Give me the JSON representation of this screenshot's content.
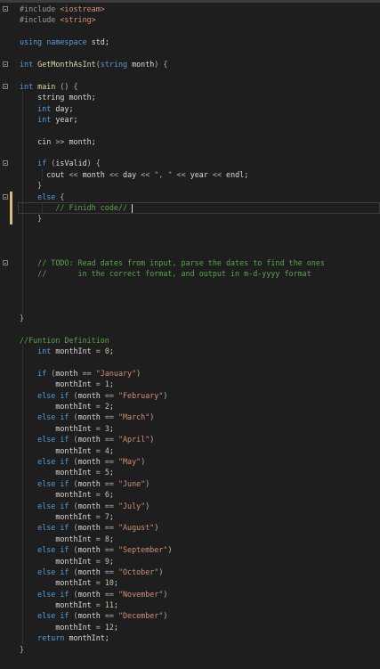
{
  "editor": {
    "lines": [
      {
        "fold": true,
        "indent": "",
        "tokens": [
          [
            "pp",
            "#include "
          ],
          [
            "str",
            "<iostream>"
          ]
        ]
      },
      {
        "fold": false,
        "indent": "",
        "tokens": [
          [
            "pp",
            "#include "
          ],
          [
            "str",
            "<string>"
          ]
        ]
      },
      {
        "fold": false,
        "indent": "",
        "tokens": []
      },
      {
        "fold": false,
        "indent": "",
        "tokens": [
          [
            "kw",
            "using "
          ],
          [
            "kw",
            "namespace "
          ],
          [
            "id",
            "std;"
          ]
        ]
      },
      {
        "fold": false,
        "indent": "",
        "tokens": []
      },
      {
        "fold": true,
        "indent": "",
        "tokens": [
          [
            "kw",
            "int "
          ],
          [
            "fn",
            "GetMonthAsInt"
          ],
          [
            "op",
            "("
          ],
          [
            "kw",
            "string "
          ],
          [
            "id",
            "month"
          ],
          [
            "op",
            ") {"
          ]
        ]
      },
      {
        "fold": false,
        "indent": "",
        "tokens": []
      },
      {
        "fold": true,
        "indent": "",
        "tokens": [
          [
            "kw",
            "int "
          ],
          [
            "fn",
            "main"
          ],
          [
            "op",
            " () {"
          ]
        ]
      },
      {
        "fold": false,
        "indent": "    ",
        "tokens": [
          [
            "id",
            "string month;"
          ]
        ]
      },
      {
        "fold": false,
        "indent": "    ",
        "tokens": [
          [
            "kw",
            "int "
          ],
          [
            "id",
            "day;"
          ]
        ]
      },
      {
        "fold": false,
        "indent": "    ",
        "tokens": [
          [
            "kw",
            "int "
          ],
          [
            "id",
            "year;"
          ]
        ]
      },
      {
        "fold": false,
        "indent": "",
        "tokens": []
      },
      {
        "fold": false,
        "indent": "    ",
        "tokens": [
          [
            "id",
            "cin "
          ],
          [
            "op",
            ">> "
          ],
          [
            "id",
            "month;"
          ]
        ]
      },
      {
        "fold": false,
        "indent": "",
        "tokens": []
      },
      {
        "fold": true,
        "indent": "    ",
        "tokens": [
          [
            "kw",
            "if "
          ],
          [
            "op",
            "("
          ],
          [
            "id",
            "isValid"
          ],
          [
            "op",
            ") {"
          ]
        ]
      },
      {
        "fold": false,
        "indent": "      ",
        "tokens": [
          [
            "id",
            "cout "
          ],
          [
            "op",
            "<< "
          ],
          [
            "id",
            "month "
          ],
          [
            "op",
            "<< "
          ],
          [
            "id",
            "day "
          ],
          [
            "op",
            "<< "
          ],
          [
            "str",
            "\", \""
          ],
          [
            "op",
            " << "
          ],
          [
            "id",
            "year "
          ],
          [
            "op",
            "<< "
          ],
          [
            "id",
            "endl;"
          ]
        ]
      },
      {
        "fold": false,
        "indent": "    ",
        "tokens": [
          [
            "op",
            "}"
          ]
        ]
      },
      {
        "fold": true,
        "indent": "    ",
        "tokens": [
          [
            "kw",
            "else "
          ],
          [
            "op",
            "{"
          ]
        ]
      },
      {
        "fold": false,
        "indent": "        ",
        "tokens": [
          [
            "cm",
            "// Finidh code// "
          ]
        ]
      },
      {
        "fold": false,
        "indent": "    ",
        "tokens": [
          [
            "op",
            "}"
          ]
        ]
      },
      {
        "fold": false,
        "indent": "",
        "tokens": []
      },
      {
        "fold": false,
        "indent": "",
        "tokens": []
      },
      {
        "fold": false,
        "indent": "",
        "tokens": []
      },
      {
        "fold": true,
        "indent": "    ",
        "tokens": [
          [
            "cm",
            "// TODO: Read dates from input, parse the dates to find the ones"
          ]
        ]
      },
      {
        "fold": false,
        "indent": "    ",
        "tokens": [
          [
            "cm",
            "//       in the correct format, and output in m-d-yyyy format"
          ]
        ]
      },
      {
        "fold": false,
        "indent": "",
        "tokens": []
      },
      {
        "fold": false,
        "indent": "",
        "tokens": []
      },
      {
        "fold": false,
        "indent": "",
        "tokens": []
      },
      {
        "fold": false,
        "indent": "",
        "tokens": [
          [
            "op",
            "}"
          ]
        ]
      },
      {
        "fold": false,
        "indent": "",
        "tokens": []
      },
      {
        "fold": false,
        "indent": "",
        "tokens": [
          [
            "cm",
            "//Funtion Definition"
          ]
        ]
      },
      {
        "fold": false,
        "indent": "    ",
        "tokens": [
          [
            "kw",
            "int "
          ],
          [
            "id",
            "monthInt "
          ],
          [
            "op",
            "= "
          ],
          [
            "num",
            "0"
          ],
          [
            "id",
            ";"
          ]
        ]
      },
      {
        "fold": false,
        "indent": "",
        "tokens": []
      },
      {
        "fold": false,
        "indent": "    ",
        "tokens": [
          [
            "kw",
            "if "
          ],
          [
            "op",
            "("
          ],
          [
            "id",
            "month "
          ],
          [
            "op",
            "== "
          ],
          [
            "str",
            "\"January\""
          ],
          [
            "op",
            ")"
          ]
        ]
      },
      {
        "fold": false,
        "indent": "        ",
        "tokens": [
          [
            "id",
            "monthInt "
          ],
          [
            "op",
            "= "
          ],
          [
            "num",
            "1"
          ],
          [
            "id",
            ";"
          ]
        ]
      },
      {
        "fold": false,
        "indent": "    ",
        "tokens": [
          [
            "kw",
            "else if "
          ],
          [
            "op",
            "("
          ],
          [
            "id",
            "month "
          ],
          [
            "op",
            "== "
          ],
          [
            "str",
            "\"February\""
          ],
          [
            "op",
            ")"
          ]
        ]
      },
      {
        "fold": false,
        "indent": "        ",
        "tokens": [
          [
            "id",
            "monthInt "
          ],
          [
            "op",
            "= "
          ],
          [
            "num",
            "2"
          ],
          [
            "id",
            ";"
          ]
        ]
      },
      {
        "fold": false,
        "indent": "    ",
        "tokens": [
          [
            "kw",
            "else if "
          ],
          [
            "op",
            "("
          ],
          [
            "id",
            "month "
          ],
          [
            "op",
            "== "
          ],
          [
            "str",
            "\"March\""
          ],
          [
            "op",
            ")"
          ]
        ]
      },
      {
        "fold": false,
        "indent": "        ",
        "tokens": [
          [
            "id",
            "monthInt "
          ],
          [
            "op",
            "= "
          ],
          [
            "num",
            "3"
          ],
          [
            "id",
            ";"
          ]
        ]
      },
      {
        "fold": false,
        "indent": "    ",
        "tokens": [
          [
            "kw",
            "else if "
          ],
          [
            "op",
            "("
          ],
          [
            "id",
            "month "
          ],
          [
            "op",
            "== "
          ],
          [
            "str",
            "\"April\""
          ],
          [
            "op",
            ")"
          ]
        ]
      },
      {
        "fold": false,
        "indent": "        ",
        "tokens": [
          [
            "id",
            "monthInt "
          ],
          [
            "op",
            "= "
          ],
          [
            "num",
            "4"
          ],
          [
            "id",
            ";"
          ]
        ]
      },
      {
        "fold": false,
        "indent": "    ",
        "tokens": [
          [
            "kw",
            "else if "
          ],
          [
            "op",
            "("
          ],
          [
            "id",
            "month "
          ],
          [
            "op",
            "== "
          ],
          [
            "str",
            "\"May\""
          ],
          [
            "op",
            ")"
          ]
        ]
      },
      {
        "fold": false,
        "indent": "        ",
        "tokens": [
          [
            "id",
            "monthInt "
          ],
          [
            "op",
            "= "
          ],
          [
            "num",
            "5"
          ],
          [
            "id",
            ";"
          ]
        ]
      },
      {
        "fold": false,
        "indent": "    ",
        "tokens": [
          [
            "kw",
            "else if "
          ],
          [
            "op",
            "("
          ],
          [
            "id",
            "month "
          ],
          [
            "op",
            "== "
          ],
          [
            "str",
            "\"June\""
          ],
          [
            "op",
            ")"
          ]
        ]
      },
      {
        "fold": false,
        "indent": "        ",
        "tokens": [
          [
            "id",
            "monthInt "
          ],
          [
            "op",
            "= "
          ],
          [
            "num",
            "6"
          ],
          [
            "id",
            ";"
          ]
        ]
      },
      {
        "fold": false,
        "indent": "    ",
        "tokens": [
          [
            "kw",
            "else if "
          ],
          [
            "op",
            "("
          ],
          [
            "id",
            "month "
          ],
          [
            "op",
            "== "
          ],
          [
            "str",
            "\"July\""
          ],
          [
            "op",
            ")"
          ]
        ]
      },
      {
        "fold": false,
        "indent": "        ",
        "tokens": [
          [
            "id",
            "monthInt "
          ],
          [
            "op",
            "= "
          ],
          [
            "num",
            "7"
          ],
          [
            "id",
            ";"
          ]
        ]
      },
      {
        "fold": false,
        "indent": "    ",
        "tokens": [
          [
            "kw",
            "else if "
          ],
          [
            "op",
            "("
          ],
          [
            "id",
            "month "
          ],
          [
            "op",
            "== "
          ],
          [
            "str",
            "\"August\""
          ],
          [
            "op",
            ")"
          ]
        ]
      },
      {
        "fold": false,
        "indent": "        ",
        "tokens": [
          [
            "id",
            "monthInt "
          ],
          [
            "op",
            "= "
          ],
          [
            "num",
            "8"
          ],
          [
            "id",
            ";"
          ]
        ]
      },
      {
        "fold": false,
        "indent": "    ",
        "tokens": [
          [
            "kw",
            "else if "
          ],
          [
            "op",
            "("
          ],
          [
            "id",
            "month "
          ],
          [
            "op",
            "== "
          ],
          [
            "str",
            "\"September\""
          ],
          [
            "op",
            ")"
          ]
        ]
      },
      {
        "fold": false,
        "indent": "        ",
        "tokens": [
          [
            "id",
            "monthInt "
          ],
          [
            "op",
            "= "
          ],
          [
            "num",
            "9"
          ],
          [
            "id",
            ";"
          ]
        ]
      },
      {
        "fold": false,
        "indent": "    ",
        "tokens": [
          [
            "kw",
            "else if "
          ],
          [
            "op",
            "("
          ],
          [
            "id",
            "month "
          ],
          [
            "op",
            "== "
          ],
          [
            "str",
            "\"October\""
          ],
          [
            "op",
            ")"
          ]
        ]
      },
      {
        "fold": false,
        "indent": "        ",
        "tokens": [
          [
            "id",
            "monthInt "
          ],
          [
            "op",
            "= "
          ],
          [
            "num",
            "10"
          ],
          [
            "id",
            ";"
          ]
        ]
      },
      {
        "fold": false,
        "indent": "    ",
        "tokens": [
          [
            "kw",
            "else if "
          ],
          [
            "op",
            "("
          ],
          [
            "id",
            "month "
          ],
          [
            "op",
            "== "
          ],
          [
            "str",
            "\"November\""
          ],
          [
            "op",
            ")"
          ]
        ]
      },
      {
        "fold": false,
        "indent": "        ",
        "tokens": [
          [
            "id",
            "monthInt "
          ],
          [
            "op",
            "= "
          ],
          [
            "num",
            "11"
          ],
          [
            "id",
            ";"
          ]
        ]
      },
      {
        "fold": false,
        "indent": "    ",
        "tokens": [
          [
            "kw",
            "else if "
          ],
          [
            "op",
            "("
          ],
          [
            "id",
            "month "
          ],
          [
            "op",
            "== "
          ],
          [
            "str",
            "\"December\""
          ],
          [
            "op",
            ")"
          ]
        ]
      },
      {
        "fold": false,
        "indent": "        ",
        "tokens": [
          [
            "id",
            "monthInt "
          ],
          [
            "op",
            "= "
          ],
          [
            "num",
            "12"
          ],
          [
            "id",
            ";"
          ]
        ]
      },
      {
        "fold": false,
        "indent": "    ",
        "tokens": [
          [
            "kw",
            "return "
          ],
          [
            "id",
            "monthInt;"
          ]
        ]
      },
      {
        "fold": false,
        "indent": "",
        "tokens": [
          [
            "op",
            "}"
          ]
        ]
      }
    ],
    "current_line": 18
  },
  "colors": {
    "background": "#1e1e1e",
    "keyword": "#569cd6",
    "function": "#dcdcaa",
    "string": "#ce9178",
    "comment": "#57a64a",
    "number": "#b5cea8",
    "modified_marker": "#d7ba7d"
  },
  "icons": {
    "fold": "minus-square-icon"
  }
}
